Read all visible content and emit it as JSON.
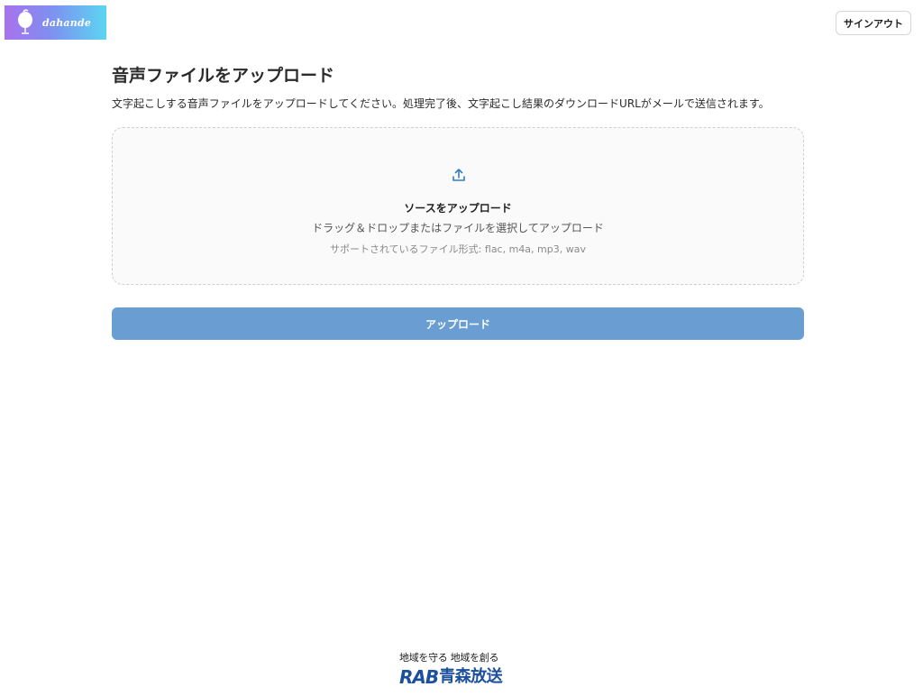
{
  "header": {
    "logo_text": "dahande",
    "signout_label": "サインアウト"
  },
  "main": {
    "title": "音声ファイルをアップロード",
    "description": "文字起こしする音声ファイルをアップロードしてください。処理完了後、文字起こし結果のダウンロードURLがメールで送信されます。",
    "dropzone": {
      "icon": "upload-icon",
      "title": "ソースをアップロード",
      "subtitle": "ドラッグ＆ドロップまたはファイルを選択してアップロード",
      "formats": "サポートされているファイル形式: flac, m4a, mp3, wav"
    },
    "upload_button_label": "アップロード"
  },
  "footer": {
    "tagline": "地域を守る 地域を創る",
    "logo_en": "RAB",
    "logo_jp": "青森放送"
  },
  "colors": {
    "accent": "#6a9ed2",
    "icon": "#2f7fc1",
    "brand_footer": "#1c4f9c"
  }
}
